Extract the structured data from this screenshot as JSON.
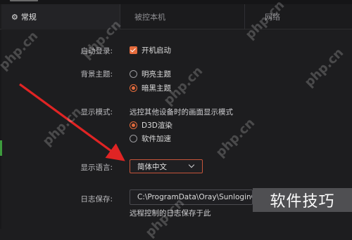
{
  "tabs": [
    {
      "icon": "⚙",
      "label": "常规",
      "active": true
    },
    {
      "label": "被控本机",
      "active": false
    },
    {
      "label": "网络",
      "active": false
    }
  ],
  "settings": {
    "startup": {
      "label": "启动登录:",
      "option": "开机启动",
      "checked": true
    },
    "theme": {
      "label": "背景主题:",
      "options": [
        "明亮主题",
        "暗黑主题"
      ],
      "selected": "暗黑主题"
    },
    "display_mode": {
      "label": "显示模式:",
      "description": "远控其他设备时的画面显示模式",
      "options": [
        "D3D渲染",
        "软件加速"
      ],
      "selected": "D3D渲染"
    },
    "language": {
      "label": "显示语言:",
      "value": "简体中文"
    },
    "log": {
      "label": "日志保存:",
      "path": "C:\\ProgramData\\Oray\\SunloginCli",
      "note": "远程控制的日志保存于此"
    }
  },
  "watermark": "php.cn",
  "corner_watermark": "软件技巧",
  "colors": {
    "accent": "#e46b3c",
    "arrow": "#e02424",
    "background": "#1d1d1f"
  }
}
